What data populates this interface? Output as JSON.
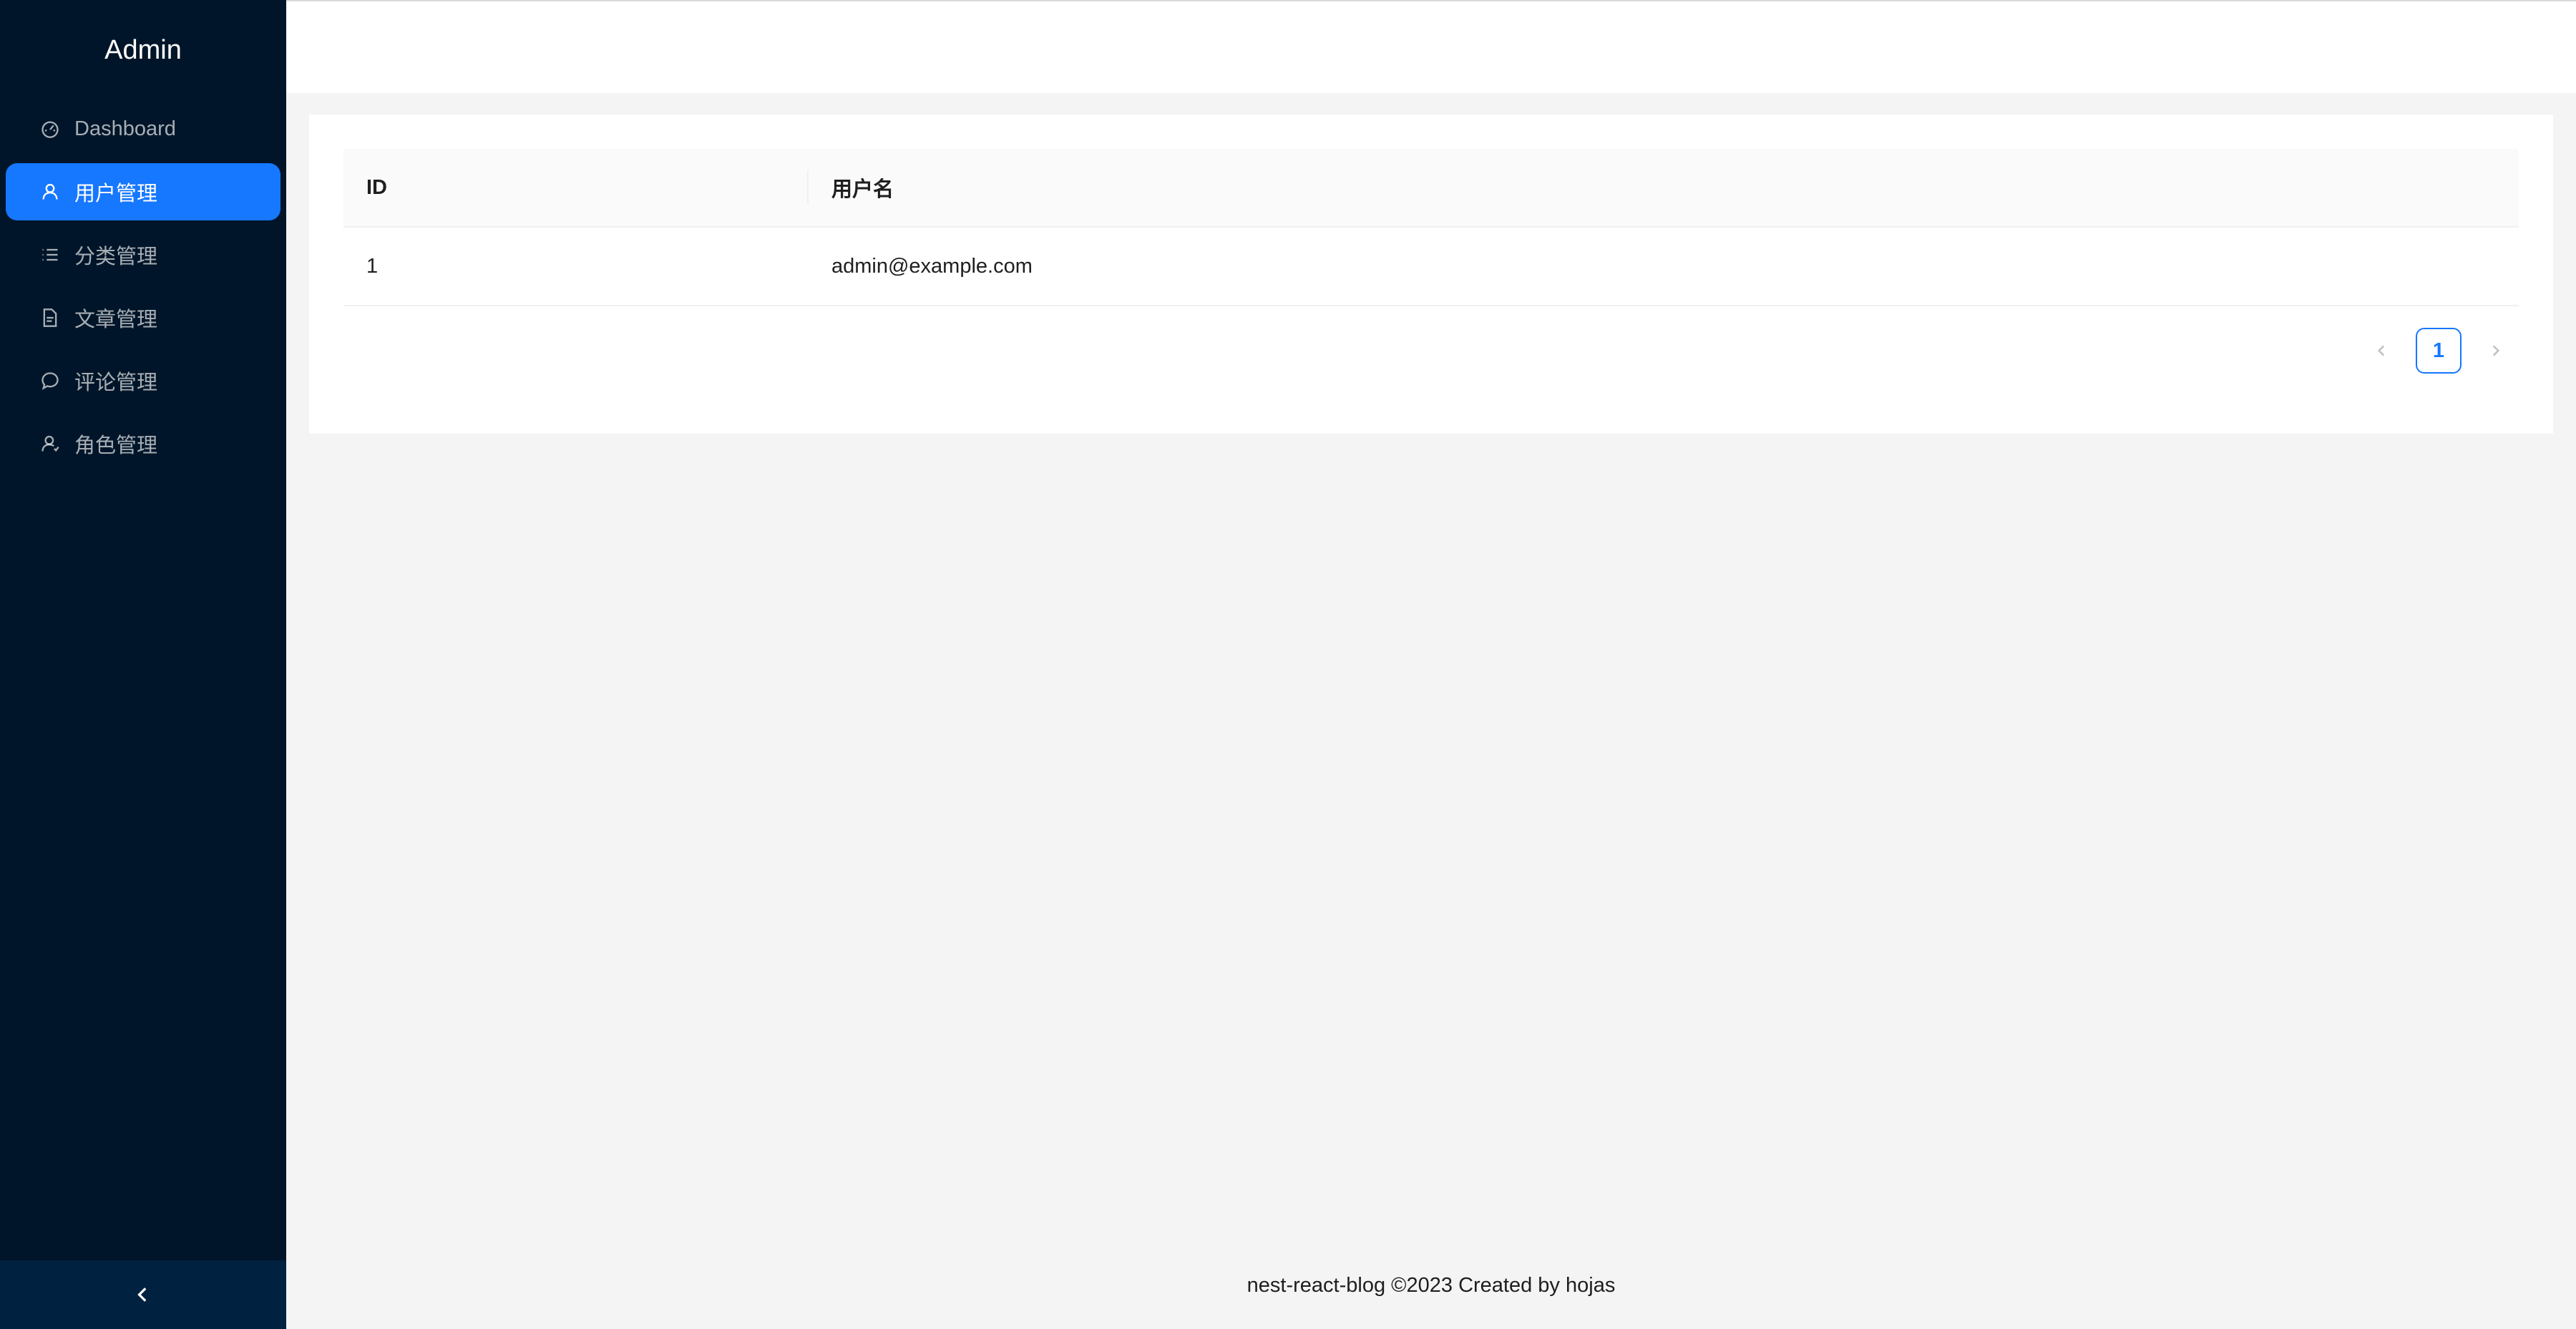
{
  "sidebar": {
    "logo": "Admin",
    "items": [
      {
        "label": "Dashboard",
        "icon": "dashboard-icon",
        "active": false
      },
      {
        "label": "用户管理",
        "icon": "user-icon",
        "active": true
      },
      {
        "label": "分类管理",
        "icon": "list-icon",
        "active": false
      },
      {
        "label": "文章管理",
        "icon": "file-icon",
        "active": false
      },
      {
        "label": "评论管理",
        "icon": "comment-icon",
        "active": false
      },
      {
        "label": "角色管理",
        "icon": "user-role-icon",
        "active": false
      }
    ],
    "collapse_icon": "chevron-left-icon"
  },
  "table": {
    "columns": [
      "ID",
      "用户名"
    ],
    "rows": [
      [
        "1",
        "admin@example.com"
      ]
    ]
  },
  "pagination": {
    "current_page": "1",
    "prev_icon": "chevron-left-icon",
    "next_icon": "chevron-right-icon"
  },
  "footer": {
    "text": "nest-react-blog ©2023 Created by hojas"
  },
  "colors": {
    "sidebar_bg": "#001529",
    "accent": "#1677ff",
    "collapse_bg": "#002140",
    "content_bg": "#f4f4f4"
  }
}
